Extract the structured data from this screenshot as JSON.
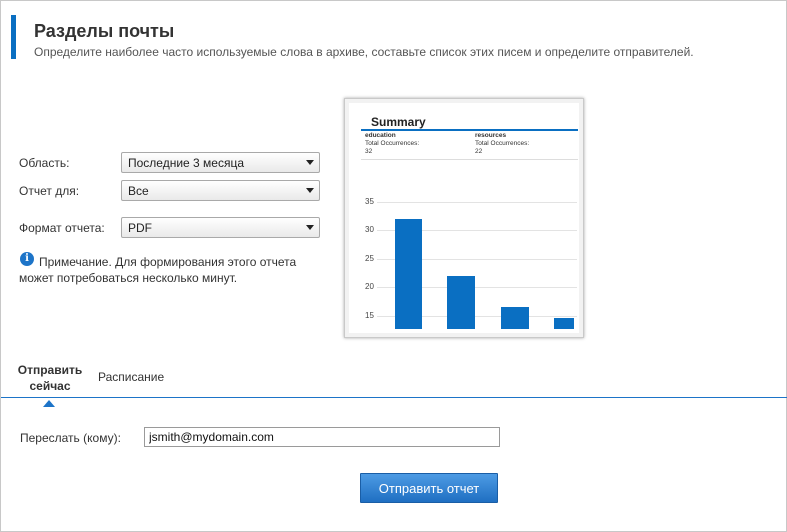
{
  "header": {
    "title": "Разделы почты",
    "subtitle": "Определите наиболее часто используемые слова в архиве, составьте список этих писем и определите отправителей."
  },
  "form": {
    "scope_label": "Область:",
    "scope_value": "Последние 3 месяца",
    "report_for_label": "Отчет для:",
    "report_for_value": "Все",
    "format_label": "Формат отчета:",
    "format_value": "PDF"
  },
  "note": {
    "icon": "info-icon",
    "text": "Примечание. Для формирования этого отчета может потребоваться несколько минут."
  },
  "preview": {
    "summary_title": "Summary",
    "cells": [
      {
        "name": "education",
        "label": "Total Occurrences:",
        "value": "32"
      },
      {
        "name": "resources",
        "label": "Total Occurrences:",
        "value": "22"
      }
    ]
  },
  "chart_data": {
    "type": "bar",
    "categories": [
      "",
      "",
      "",
      ""
    ],
    "values": [
      32,
      22,
      16.5,
      14.5
    ],
    "ylim": [
      13,
      35
    ],
    "yticks": [
      "35",
      "30",
      "25",
      "20",
      "15"
    ],
    "grid": true,
    "color": "#0a6fc2"
  },
  "tabs": [
    {
      "label": "Отправить сейчас",
      "active": true
    },
    {
      "label": "Расписание",
      "active": false
    }
  ],
  "send": {
    "forward_label": "Переслать (кому):",
    "forward_value": "jsmith@mydomain.com",
    "button_label": "Отправить отчет"
  },
  "colors": {
    "accent": "#0a6fc2",
    "button": "#2f80d0"
  }
}
